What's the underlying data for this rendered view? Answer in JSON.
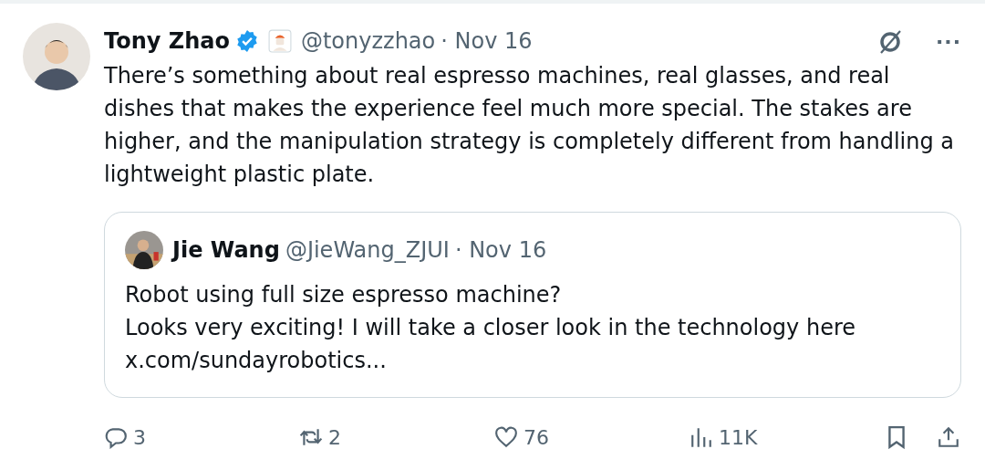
{
  "tweet": {
    "author": "Tony Zhao",
    "verified": true,
    "handle": "@tonyzzhao",
    "date": "· Nov 16",
    "text": "There’s something about real espresso machines, real glasses, and real dishes that makes the experience feel much more special. The stakes are higher, and the manipulation strategy is completely different from handling a lightweight plastic plate.",
    "more": "···"
  },
  "quote": {
    "author": "Jie Wang",
    "handle": "@JieWang_ZJUI",
    "date": "· Nov 16",
    "lines": [
      "Robot using full size espresso machine?",
      "Looks very exciting! I will take a closer look in the technology here",
      "x.com/sundayrobotics..."
    ]
  },
  "actions": [
    {
      "kind": "reply",
      "count": "3"
    },
    {
      "kind": "repost",
      "count": "2"
    },
    {
      "kind": "like",
      "count": "76"
    },
    {
      "kind": "views",
      "count": "11K"
    },
    {
      "kind": "bookmark"
    },
    {
      "kind": "share"
    }
  ]
}
